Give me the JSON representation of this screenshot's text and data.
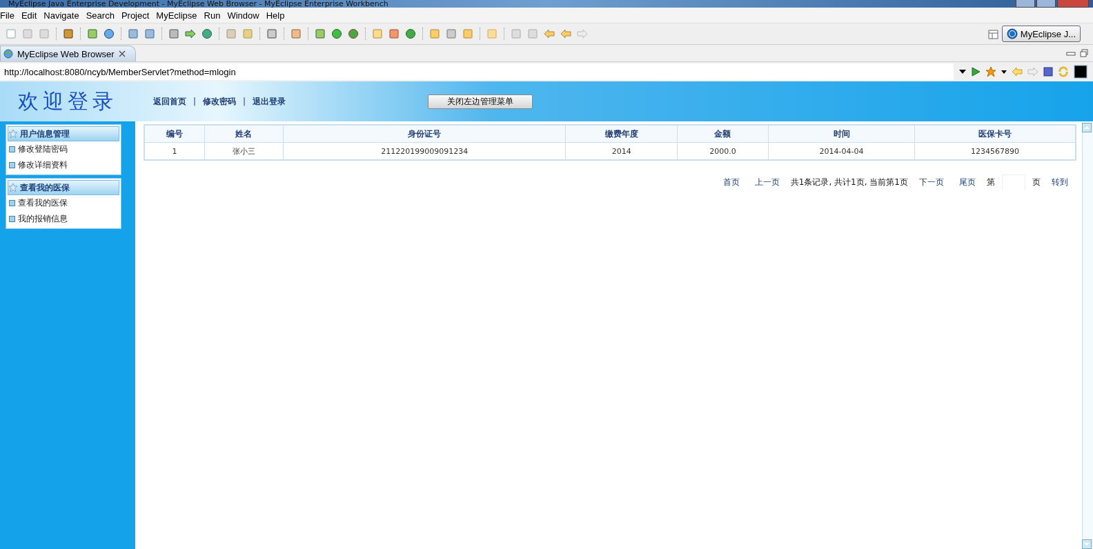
{
  "window": {
    "title": "MyEclipse Java Enterprise Development - MyEclipse Web Browser - MyEclipse Enterprise Workbench"
  },
  "menu": [
    "File",
    "Edit",
    "Navigate",
    "Search",
    "Project",
    "MyEclipse",
    "Run",
    "Window",
    "Help"
  ],
  "perspective": {
    "label": "MyEclipse J..."
  },
  "editor_tabs": [
    {
      "label": "MyEclipse Web Browser",
      "selected": true
    }
  ],
  "address": {
    "value": "http://localhost:8080/ncyb/MemberServlet?method=mlogin"
  },
  "page": {
    "header": {
      "title": "欢迎登录",
      "links": [
        "返回首页",
        "修改密码",
        "退出登录"
      ],
      "separator": "|",
      "button": "关闭左边管理菜单"
    },
    "sidebar": [
      {
        "title": "用户信息管理",
        "items": [
          "修改登陆密码",
          "修改详细资料"
        ]
      },
      {
        "title": "查看我的医保",
        "items": [
          "查看我的医保",
          "我的报销信息"
        ]
      }
    ],
    "table": {
      "columns": [
        "编号",
        "姓名",
        "身份证号",
        "缴费年度",
        "金额",
        "时间",
        "医保卡号"
      ],
      "rows": [
        [
          "1",
          "张小三",
          "211220199009091234",
          "2014",
          "2000.0",
          "2014-04-04",
          "1234567890"
        ]
      ]
    },
    "pagination": [
      {
        "kind": "link",
        "text": "首页"
      },
      {
        "kind": "link",
        "text": "上一页"
      },
      {
        "kind": "info",
        "text": "共1条记录, 共计1页, 当前第1页"
      },
      {
        "kind": "link",
        "text": "下一页"
      },
      {
        "kind": "link",
        "text": "尾页"
      },
      {
        "kind": "info",
        "text": "第"
      },
      {
        "kind": "input"
      },
      {
        "kind": "info",
        "text": "页"
      },
      {
        "kind": "link",
        "text": "转到"
      }
    ]
  }
}
